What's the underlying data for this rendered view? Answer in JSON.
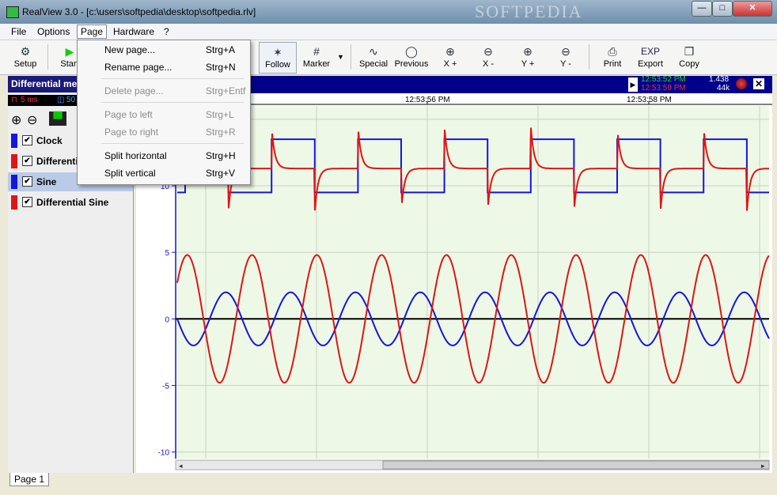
{
  "window": {
    "title": "RealView 3.0 - [c:\\users\\softpedia\\desktop\\softpedia.rlv]",
    "watermark": "SOFTPEDIA"
  },
  "menubar": [
    "File",
    "Options",
    "Page",
    "Hardware",
    "?"
  ],
  "toolbar": {
    "setup": "Setup",
    "start": "Start",
    "follow": "Follow",
    "marker": "Marker",
    "special": "Special",
    "previous": "Previous",
    "x_plus": "X +",
    "x_minus": "X -",
    "y_plus": "Y +",
    "y_minus": "Y -",
    "print": "Print",
    "export": "Export",
    "copy": "Copy",
    "export_icon": "EXP"
  },
  "page_menu": [
    {
      "label": "New page...",
      "shortcut": "Strg+A",
      "enabled": true
    },
    {
      "label": "Rename page...",
      "shortcut": "Strg+N",
      "enabled": true
    },
    {
      "label": "Delete page...",
      "shortcut": "Strg+Entf",
      "enabled": false
    },
    {
      "label": "Page to left",
      "shortcut": "Strg+L",
      "enabled": false
    },
    {
      "label": "Page to right",
      "shortcut": "Strg+R",
      "enabled": false
    },
    {
      "label": "Split horizontal",
      "shortcut": "Strg+H",
      "enabled": true
    },
    {
      "label": "Split vertical",
      "shortcut": "Strg+V",
      "enabled": true
    }
  ],
  "side": {
    "header": "Differential me",
    "status_ms": "5 ms",
    "status_count": "50",
    "channels": [
      {
        "name": "Clock",
        "color": "#1515e0",
        "checked": true
      },
      {
        "name": "Differential",
        "color": "#e01515",
        "checked": true
      },
      {
        "name": "Sine",
        "color": "#1515e0",
        "checked": true
      },
      {
        "name": "Differential Sine",
        "color": "#e01515",
        "checked": true
      }
    ]
  },
  "chart_header": {
    "time1": "12:53:52 PM",
    "time2": "12:53:59 PM",
    "value": "1.438",
    "rate": "44k"
  },
  "chart_data": {
    "type": "line",
    "time_ticks": [
      "12:53:56 PM",
      "12:53:58 PM"
    ],
    "y_ticks": [
      15,
      10,
      5,
      0,
      -5,
      -10
    ],
    "ylim": [
      -10.5,
      16
    ],
    "grid": true,
    "series": [
      {
        "name": "Clock",
        "color": "#1515e0",
        "low": 9.5,
        "high": 13.5,
        "period_fraction": 0.146
      },
      {
        "name": "Differential",
        "color": "#e01515",
        "baseline": 11.3,
        "spike": 14.5,
        "dip": 8.0
      },
      {
        "name": "Sine",
        "color": "#1515e0",
        "amplitude": 2.0
      },
      {
        "name": "Differential Sine",
        "color": "#e01515",
        "amplitude": 4.8
      }
    ]
  },
  "tabs": [
    "Page 1"
  ]
}
